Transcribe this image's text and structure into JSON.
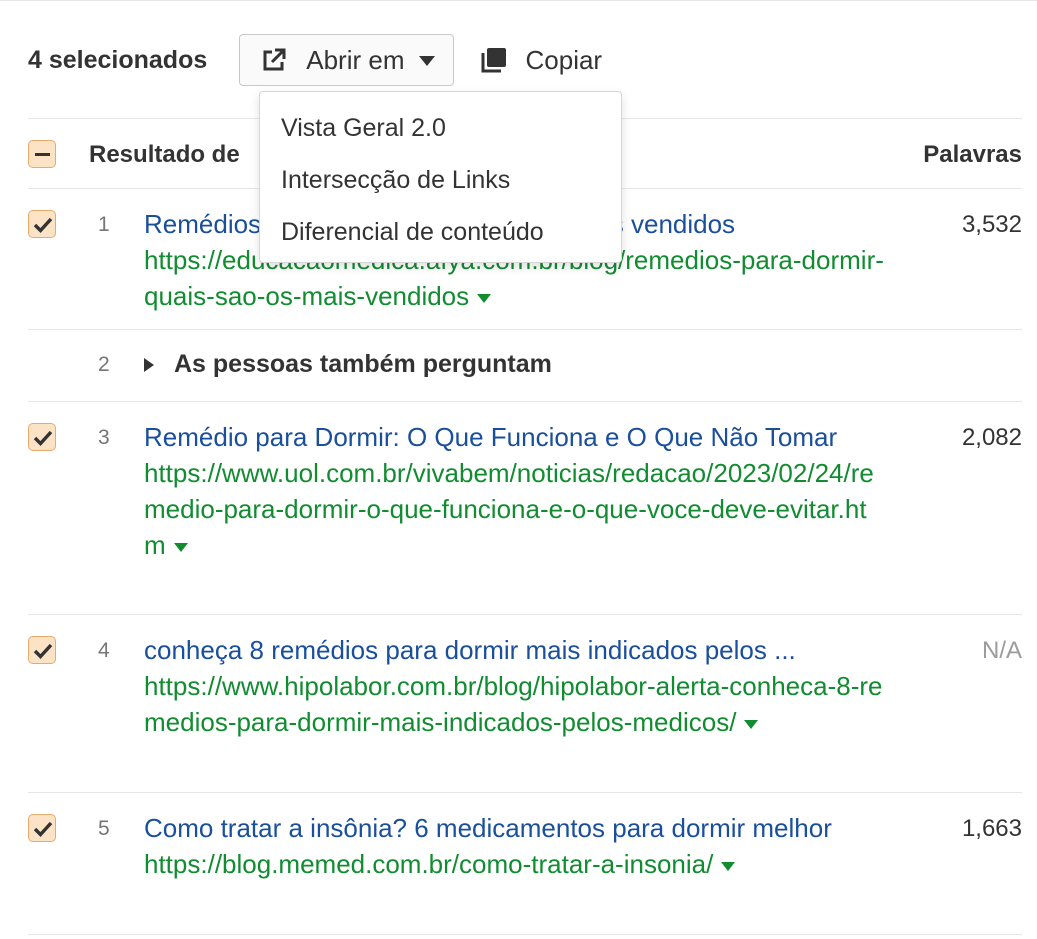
{
  "toolbar": {
    "selected_count": "4 selecionados",
    "open_in_label": "Abrir em",
    "copy_label": "Copiar"
  },
  "dropdown": {
    "items": [
      "Vista Geral 2.0",
      "Intersecção de Links",
      "Diferencial de conteúdo"
    ]
  },
  "table": {
    "header_title": "Resultado de",
    "header_words": "Palavras",
    "rows": [
      {
        "num": "1",
        "title": "Remédios para dormir: quais são os mais vendidos",
        "url": "https://educacaomedica.afya.com.br/blog/remedios-para-dormir-quais-sao-os-mais-vendidos",
        "words": "3,532",
        "checked": true
      },
      {
        "num": "2",
        "paa_label": "As pessoas também perguntam"
      },
      {
        "num": "3",
        "title": "Remédio para Dormir: O Que Funciona e O Que Não Tomar",
        "url": "https://www.uol.com.br/vivabem/noticias/redacao/2023/02/24/remedio-para-dormir-o-que-funciona-e-o-que-voce-deve-evitar.htm",
        "words": "2,082",
        "checked": true
      },
      {
        "num": "4",
        "title": "conheça 8 remédios para dormir mais indicados pelos ...",
        "url": "https://www.hipolabor.com.br/blog/hipolabor-alerta-conheca-8-remedios-para-dormir-mais-indicados-pelos-medicos/",
        "words": "N/A",
        "checked": true
      },
      {
        "num": "5",
        "title": "Como tratar a insônia? 6 medicamentos para dormir melhor",
        "url": "https://blog.memed.com.br/como-tratar-a-insonia/",
        "words": "1,663",
        "checked": true
      }
    ]
  },
  "colors": {
    "title_link": "#1a4f9c",
    "url_link": "#128c31",
    "checkbox_fill": "#fde3c6",
    "checkbox_border": "#e8a96b"
  }
}
